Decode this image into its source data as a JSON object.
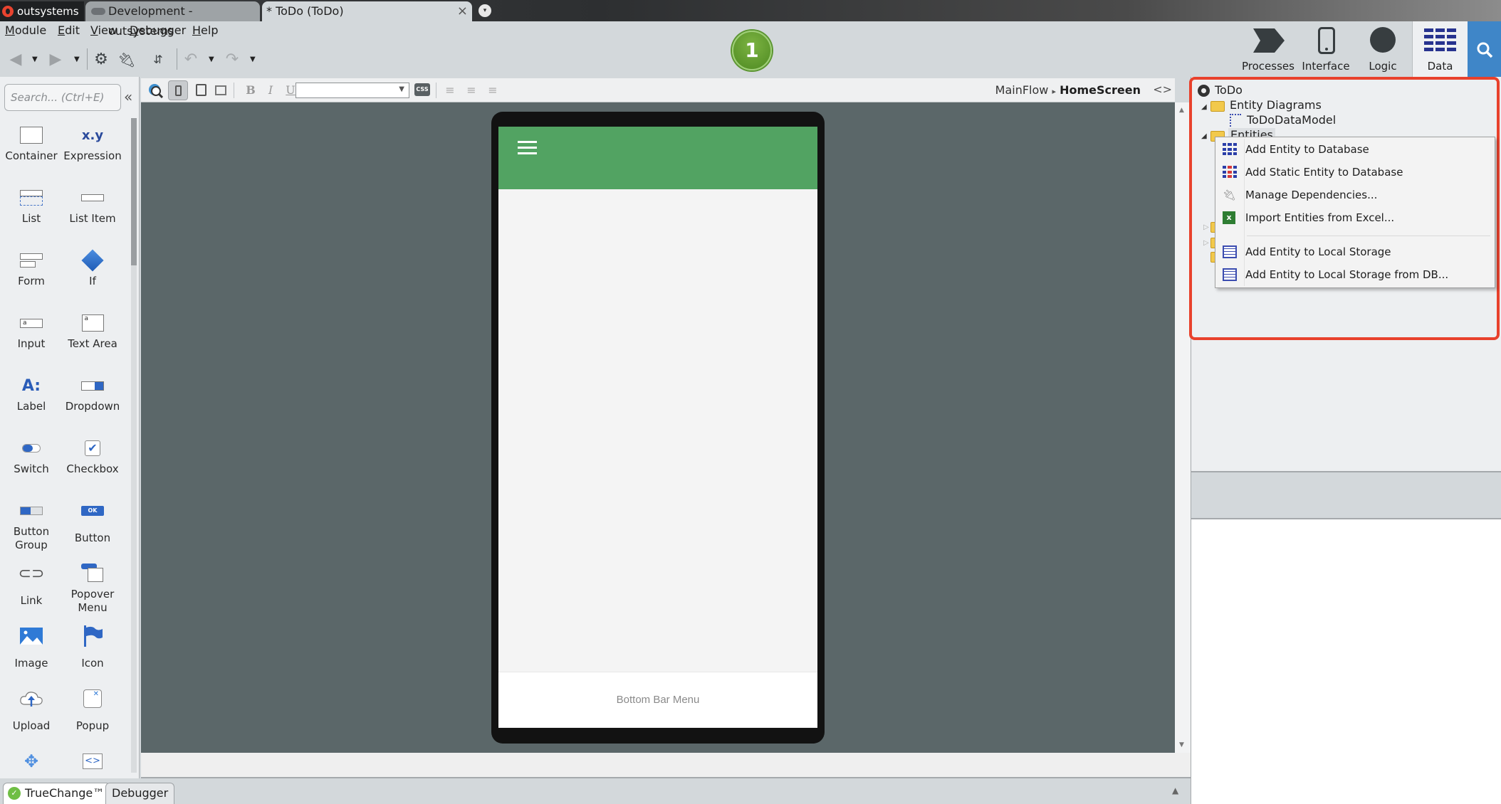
{
  "window": {
    "tabs": [
      {
        "label": "outsystems",
        "icon": "outsystems-logo-icon"
      },
      {
        "label": "Development - outsystems",
        "icon": "cloud-icon"
      },
      {
        "label": "* ToDo (ToDo)",
        "active": true,
        "close": "×"
      }
    ],
    "tab_menu_glyph": "▾"
  },
  "menubar": {
    "items": [
      {
        "label": "Module",
        "mnemonic": "M",
        "rest": "odule"
      },
      {
        "label": "Edit",
        "mnemonic": "E",
        "rest": "dit"
      },
      {
        "label": "View",
        "mnemonic": "V",
        "rest": "iew"
      },
      {
        "label": "Debugger",
        "mnemonic": "D",
        "rest": "ebugger"
      },
      {
        "label": "Help",
        "mnemonic": "H",
        "rest": "elp"
      }
    ]
  },
  "toolbar": {
    "buttons": [
      "back-icon",
      "forward-icon",
      "settings-icon",
      "plug-icon",
      "merge-icon",
      "undo-icon",
      "redo-icon"
    ],
    "step_badge": "1"
  },
  "top_tabs": [
    {
      "label": "Processes",
      "icon": "processes-icon"
    },
    {
      "label": "Interface",
      "icon": "mobile-icon"
    },
    {
      "label": "Logic",
      "icon": "logic-icon"
    },
    {
      "label": "Data",
      "icon": "data-grid-icon",
      "active": true
    },
    {
      "label": "",
      "icon": "search-icon"
    }
  ],
  "toolbox": {
    "search_placeholder": "Search... (Ctrl+E)",
    "collapse_glyph": "«",
    "widgets": [
      {
        "label": "Container",
        "icon": "container-icon"
      },
      {
        "label": "Expression",
        "icon": "expression-icon",
        "glyph": "x.y"
      },
      {
        "label": "List",
        "icon": "list-icon"
      },
      {
        "label": "List Item",
        "icon": "list-item-icon"
      },
      {
        "label": "Form",
        "icon": "form-icon"
      },
      {
        "label": "If",
        "icon": "if-diamond-icon"
      },
      {
        "label": "Input",
        "icon": "input-icon",
        "glyph": "a"
      },
      {
        "label": "Text Area",
        "icon": "text-area-icon",
        "glyph": "a"
      },
      {
        "label": "Label",
        "icon": "label-icon",
        "glyph": "A:"
      },
      {
        "label": "Dropdown",
        "icon": "dropdown-icon"
      },
      {
        "label": "Switch",
        "icon": "switch-icon"
      },
      {
        "label": "Checkbox",
        "icon": "checkbox-icon"
      },
      {
        "label": "Button Group",
        "icon": "button-group-icon"
      },
      {
        "label": "Button",
        "icon": "button-icon",
        "glyph": "OK"
      },
      {
        "label": "Link",
        "icon": "link-icon"
      },
      {
        "label": "Popover Menu",
        "icon": "popover-menu-icon"
      },
      {
        "label": "Image",
        "icon": "image-icon"
      },
      {
        "label": "Icon",
        "icon": "flag-icon"
      },
      {
        "label": "Upload",
        "icon": "upload-icon"
      },
      {
        "label": "Popup",
        "icon": "popup-icon"
      },
      {
        "label": "",
        "icon": "block-puzzle-icon"
      },
      {
        "label": "",
        "icon": "html-element-icon",
        "glyph": "<>"
      }
    ]
  },
  "editor_toolbar": {
    "bold": "B",
    "italic": "I",
    "underline": "U",
    "style_select_value": "",
    "css_label": "CSS",
    "breadcrumb": {
      "flow": "MainFlow",
      "separator": "▸",
      "screen": "HomeScreen"
    },
    "code_toggle": "<>"
  },
  "canvas": {
    "header_color": "#52a362",
    "bottom_bar_text": "Bottom Bar Menu"
  },
  "bottom_tabs": [
    {
      "label": "TrueChange™",
      "status": "ok",
      "active": true
    },
    {
      "label": "Debugger"
    }
  ],
  "data_tree": {
    "root": "ToDo",
    "items": [
      {
        "label": "Entity Diagrams",
        "expanded": true,
        "children": [
          "ToDoDataModel"
        ]
      },
      {
        "label": "Entities",
        "expanded": true,
        "selected": true
      }
    ]
  },
  "context_menu": {
    "items": [
      {
        "label": "Add Entity to Database",
        "icon": "entity-icon"
      },
      {
        "label": "Add Static Entity to Database",
        "icon": "static-entity-icon"
      },
      {
        "label": "Manage Dependencies...",
        "icon": "plug-icon"
      },
      {
        "label": "Import Entities from Excel...",
        "icon": "excel-icon"
      },
      {
        "label": "Add Entity to Local Storage",
        "icon": "local-entity-icon"
      },
      {
        "label": "Add Entity to Local Storage from DB...",
        "icon": "local-entity-icon"
      }
    ]
  },
  "colors": {
    "highlight_box": "#e8412c",
    "canvas_bg": "#5b6769",
    "search_tab": "#3f86c8",
    "entity_blue": "#2b3ea8"
  }
}
